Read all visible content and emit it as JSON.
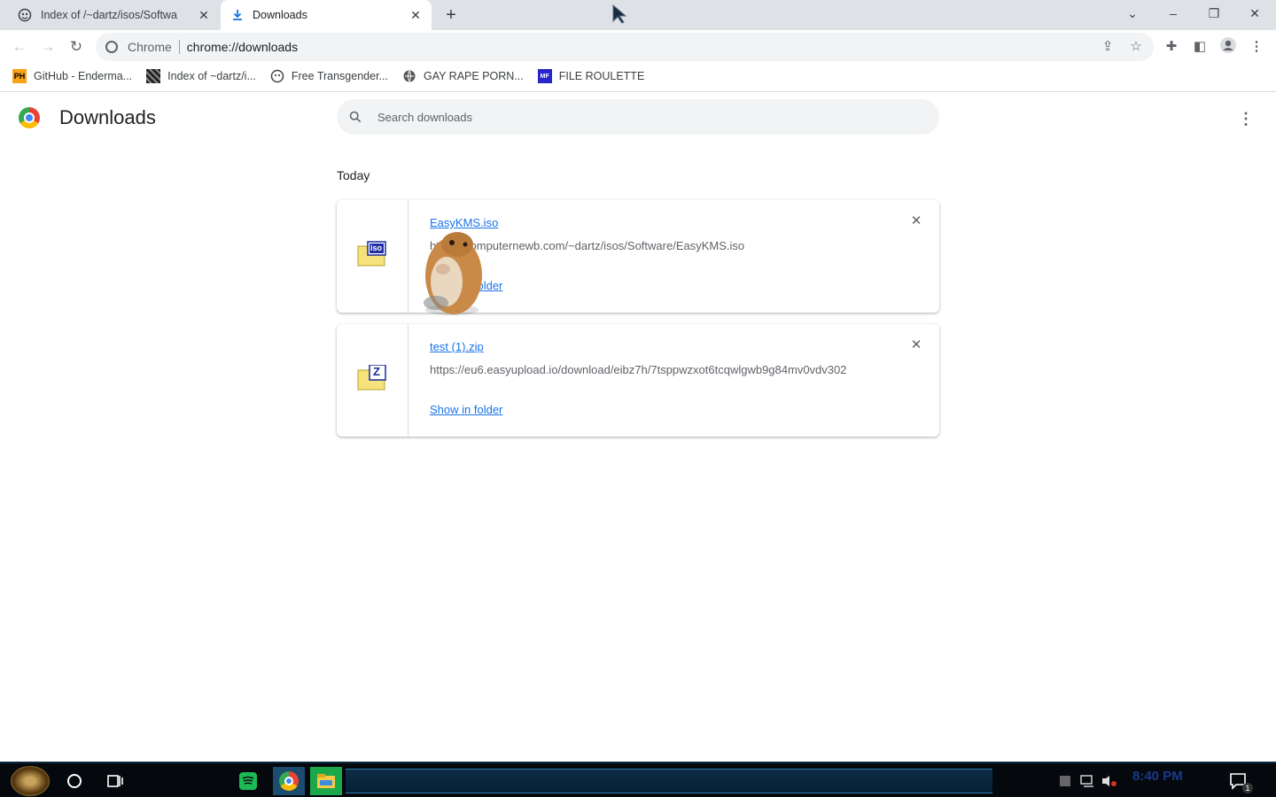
{
  "tabs": [
    {
      "title": "Index of /~dartz/isos/Softwa",
      "active": false,
      "icon": "web-icon"
    },
    {
      "title": "Downloads",
      "active": true,
      "icon": "download-icon"
    }
  ],
  "window_controls": {
    "list": "⌄",
    "minimize": "–",
    "restore": "❐",
    "close": "✕"
  },
  "toolbar": {
    "chrome_label": "Chrome",
    "url": "chrome://downloads"
  },
  "bookmarks": [
    {
      "label": "GitHub - Enderma...",
      "icon": "ph-icon",
      "badge": "PH",
      "color": "#f7a319"
    },
    {
      "label": "Index of ~dartz/i...",
      "icon": "pixel-icon",
      "badge": "",
      "color": "#333333"
    },
    {
      "label": "Free Transgender...",
      "icon": "web-icon",
      "badge": "",
      "color": "#555555"
    },
    {
      "label": "GAY RAPE PORN...",
      "icon": "globe-icon",
      "badge": "",
      "color": "#555555"
    },
    {
      "label": "FILE ROULETTE",
      "icon": "mf-icon",
      "badge": "MF",
      "color": "#2626c9"
    }
  ],
  "downloads_page": {
    "title": "Downloads",
    "search_placeholder": "Search downloads",
    "section": "Today",
    "items": [
      {
        "file_name": "EasyKMS.iso",
        "url": "https://computernewb.com/~dartz/isos/Software/EasyKMS.iso",
        "action": "Show in folder",
        "icon": "iso-file-icon",
        "badge": "iso"
      },
      {
        "file_name": "test (1).zip",
        "url": "https://eu6.easyupload.io/download/eibz7h/7tsppwzxot6tcqwlgwb9g84mv0vdv302",
        "action": "Show in folder",
        "icon": "zip-file-icon",
        "badge": "Z"
      }
    ]
  },
  "taskbar": {
    "clock": "8:40 PM",
    "notification_count": "1"
  }
}
